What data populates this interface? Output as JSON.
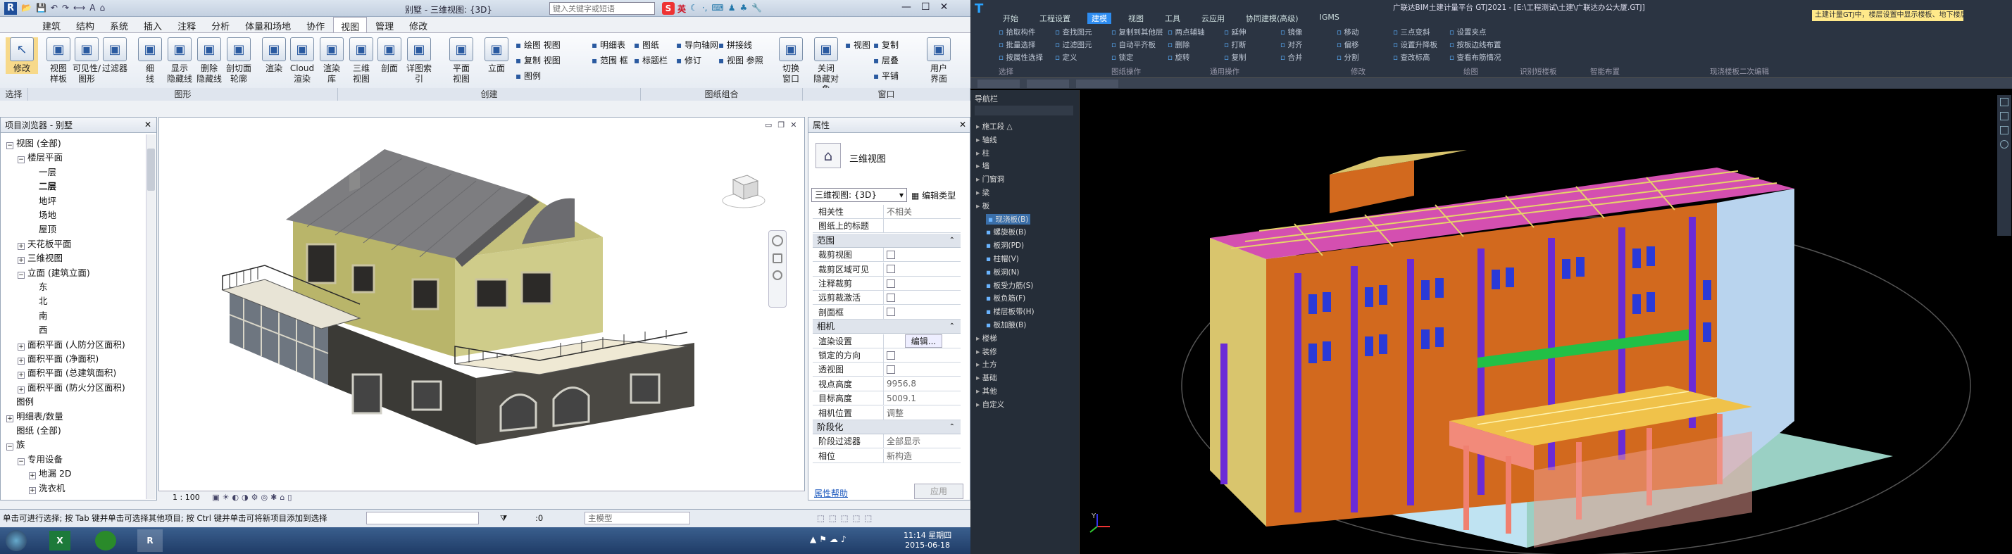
{
  "revit": {
    "title": "别墅 - 三维视图: {3D}",
    "search_placeholder": "键入关键字或短语",
    "ime_label": "英",
    "tabs": [
      "建筑",
      "结构",
      "系统",
      "插入",
      "注释",
      "分析",
      "体量和场地",
      "协作",
      "视图",
      "管理",
      "修改"
    ],
    "active_tab": "视图",
    "ribbon_groups": [
      "选择",
      "图形",
      "创建",
      "图纸组合",
      "窗口"
    ],
    "ribbon_buttons": [
      {
        "label": "修改",
        "icon": "cursor-icon"
      },
      {
        "label": "视图\n样板",
        "icon": "view-template-icon"
      },
      {
        "label": "可见性/\n图形",
        "icon": "visibility-icon"
      },
      {
        "label": "过滤器",
        "icon": "filter-icon"
      },
      {
        "label": "细\n线",
        "icon": "thin-lines-icon"
      },
      {
        "label": "显示\n隐藏线",
        "icon": "show-hidden-icon"
      },
      {
        "label": "删除\n隐藏线",
        "icon": "remove-hidden-icon"
      },
      {
        "label": "剖切面\n轮廓",
        "icon": "cut-profile-icon"
      },
      {
        "label": "渲染",
        "icon": "render-icon"
      },
      {
        "label": "Cloud\n渲染",
        "icon": "cloud-render-icon"
      },
      {
        "label": "渲染\n库",
        "icon": "render-gallery-icon"
      },
      {
        "label": "三维\n视图",
        "icon": "3d-view-icon"
      },
      {
        "label": "剖面",
        "icon": "section-icon"
      },
      {
        "label": "详图索引",
        "icon": "callout-icon"
      },
      {
        "label": "平面\n视图",
        "icon": "plan-view-icon"
      },
      {
        "label": "立面",
        "icon": "elevation-icon"
      },
      {
        "label": "切换\n窗口",
        "icon": "switch-window-icon"
      },
      {
        "label": "关闭\n隐藏对象",
        "icon": "close-hidden-icon"
      },
      {
        "label": "用户\n界面",
        "icon": "user-interface-icon"
      }
    ],
    "ribbon_small": [
      "绘图 视图",
      "复制 视图",
      "图例",
      "明细表",
      "范围 框",
      "图纸",
      "标题栏",
      "修订",
      "视图 参照",
      "导向轴网",
      "拼接线",
      "视图",
      "复制",
      "层叠",
      "平铺"
    ],
    "project_browser": {
      "title": "项目浏览器 - 别墅",
      "items": [
        {
          "label": "视图 (全部)",
          "level": 0,
          "toggle": "−"
        },
        {
          "label": "楼层平面",
          "level": 1,
          "toggle": "−"
        },
        {
          "label": "一层",
          "level": 2,
          "toggle": ""
        },
        {
          "label": "二层",
          "level": 2,
          "toggle": ""
        },
        {
          "label": "地坪",
          "level": 2,
          "toggle": ""
        },
        {
          "label": "场地",
          "level": 2,
          "toggle": ""
        },
        {
          "label": "屋顶",
          "level": 2,
          "toggle": ""
        },
        {
          "label": "天花板平面",
          "level": 1,
          "toggle": "+"
        },
        {
          "label": "三维视图",
          "level": 1,
          "toggle": "+"
        },
        {
          "label": "立面 (建筑立面)",
          "level": 1,
          "toggle": "−"
        },
        {
          "label": "东",
          "level": 2,
          "toggle": ""
        },
        {
          "label": "北",
          "level": 2,
          "toggle": ""
        },
        {
          "label": "南",
          "level": 2,
          "toggle": ""
        },
        {
          "label": "西",
          "level": 2,
          "toggle": ""
        },
        {
          "label": "面积平面 (人防分区面积)",
          "level": 1,
          "toggle": "+"
        },
        {
          "label": "面积平面 (净面积)",
          "level": 1,
          "toggle": "+"
        },
        {
          "label": "面积平面 (总建筑面积)",
          "level": 1,
          "toggle": "+"
        },
        {
          "label": "面积平面 (防火分区面积)",
          "level": 1,
          "toggle": "+"
        },
        {
          "label": "图例",
          "level": 0,
          "toggle": ""
        },
        {
          "label": "明细表/数量",
          "level": 0,
          "toggle": "+"
        },
        {
          "label": "图纸 (全部)",
          "level": 0,
          "toggle": ""
        },
        {
          "label": "族",
          "level": 0,
          "toggle": "−"
        },
        {
          "label": "专用设备",
          "level": 1,
          "toggle": "−"
        },
        {
          "label": "地漏 2D",
          "level": 2,
          "toggle": "+"
        },
        {
          "label": "洗衣机",
          "level": 2,
          "toggle": "+"
        }
      ]
    },
    "properties": {
      "title": "属性",
      "type_name": "三维视图",
      "selector": "三维视图: {3D}",
      "edit_type": "编辑类型",
      "rows": [
        {
          "kind": "row",
          "k": "相关性",
          "v": "不相关"
        },
        {
          "kind": "row",
          "k": "图纸上的标题",
          "v": ""
        },
        {
          "kind": "sect",
          "k": "范围"
        },
        {
          "kind": "cb",
          "k": "裁剪视图"
        },
        {
          "kind": "cb",
          "k": "裁剪区域可见"
        },
        {
          "kind": "cb",
          "k": "注释裁剪"
        },
        {
          "kind": "cb",
          "k": "远剪裁激活"
        },
        {
          "kind": "cb",
          "k": "剖面框"
        },
        {
          "kind": "sect",
          "k": "相机"
        },
        {
          "kind": "row",
          "k": "渲染设置",
          "v": "编辑..."
        },
        {
          "kind": "cb",
          "k": "锁定的方向"
        },
        {
          "kind": "cb",
          "k": "透视图"
        },
        {
          "kind": "row",
          "k": "视点高度",
          "v": "9956.8"
        },
        {
          "kind": "row",
          "k": "目标高度",
          "v": "5009.1"
        },
        {
          "kind": "row",
          "k": "相机位置",
          "v": "调整"
        },
        {
          "kind": "sect",
          "k": "阶段化"
        },
        {
          "kind": "row",
          "k": "阶段过滤器",
          "v": "全部显示"
        },
        {
          "kind": "row",
          "k": "相位",
          "v": "新构造"
        }
      ],
      "help_link": "属性帮助",
      "apply": "应用"
    },
    "view_scale": "1 : 100",
    "status_text": "单击可进行选择; 按 Tab 键并单击可选择其他项目; 按 Ctrl 键并单击可将新项目添加到选择",
    "status_coord": ":0",
    "model_select": "主模型",
    "taskbar": {
      "time": "11:14 星期四",
      "date": "2015-06-18"
    }
  },
  "gtj": {
    "title": "广联达BIM土建计量平台 GTJ2021 - [E:\\工程测试\\土建\\广联达办公大厦.GTJ]",
    "notice": "土建计量GTJ中，楼层设置中显示楼板、地下楼层面积",
    "tabs": [
      "开始",
      "工程设置",
      "建模",
      "视图",
      "工具",
      "云应用",
      "协同建模(高级)",
      "IGMS"
    ],
    "active_tab": "建模",
    "groups": [
      "选择",
      "图纸操作",
      "通用操作",
      "修改",
      "绘图",
      "识别短楼板",
      "智能布置",
      "现浇楼板二次编辑"
    ],
    "small_cmds": [
      "拾取构件",
      "批量选择",
      "按属性选择",
      "查找图元",
      "过滤图元",
      "定义",
      "复制到其他层",
      "自动平齐板",
      "锁定",
      "两点辅轴",
      "删除",
      "旋转",
      "延伸",
      "打断",
      "复制",
      "镜像",
      "对齐",
      "合并",
      "移动",
      "偏移",
      "分割",
      "三点变斜",
      "设置升降板",
      "查改标高",
      "设置夹点",
      "按板边线布置",
      "查看布筋情况"
    ],
    "nav_title": "导航栏",
    "nav_items": [
      {
        "label": "施工段 △",
        "level": 0
      },
      {
        "label": "轴线",
        "level": 0
      },
      {
        "label": "柱",
        "level": 0
      },
      {
        "label": "墙",
        "level": 0
      },
      {
        "label": "门窗洞",
        "level": 0
      },
      {
        "label": "梁",
        "level": 0
      },
      {
        "label": "板",
        "level": 0
      },
      {
        "label": "现浇板(B)",
        "level": 1
      },
      {
        "label": "螺旋板(B)",
        "level": 1
      },
      {
        "label": "板洞(PD)",
        "level": 1
      },
      {
        "label": "柱帽(V)",
        "level": 1
      },
      {
        "label": "板洞(N)",
        "level": 1
      },
      {
        "label": "板受力筋(S)",
        "level": 1
      },
      {
        "label": "板负筋(F)",
        "level": 1
      },
      {
        "label": "楼层板带(H)",
        "level": 1
      },
      {
        "label": "板加腋(B)",
        "level": 1
      },
      {
        "label": "楼梯",
        "level": 0
      },
      {
        "label": "装修",
        "level": 0
      },
      {
        "label": "土方",
        "level": 0
      },
      {
        "label": "基础",
        "level": 0
      },
      {
        "label": "其他",
        "level": 0
      },
      {
        "label": "自定义",
        "level": 0
      }
    ],
    "axis_label": "Y"
  }
}
